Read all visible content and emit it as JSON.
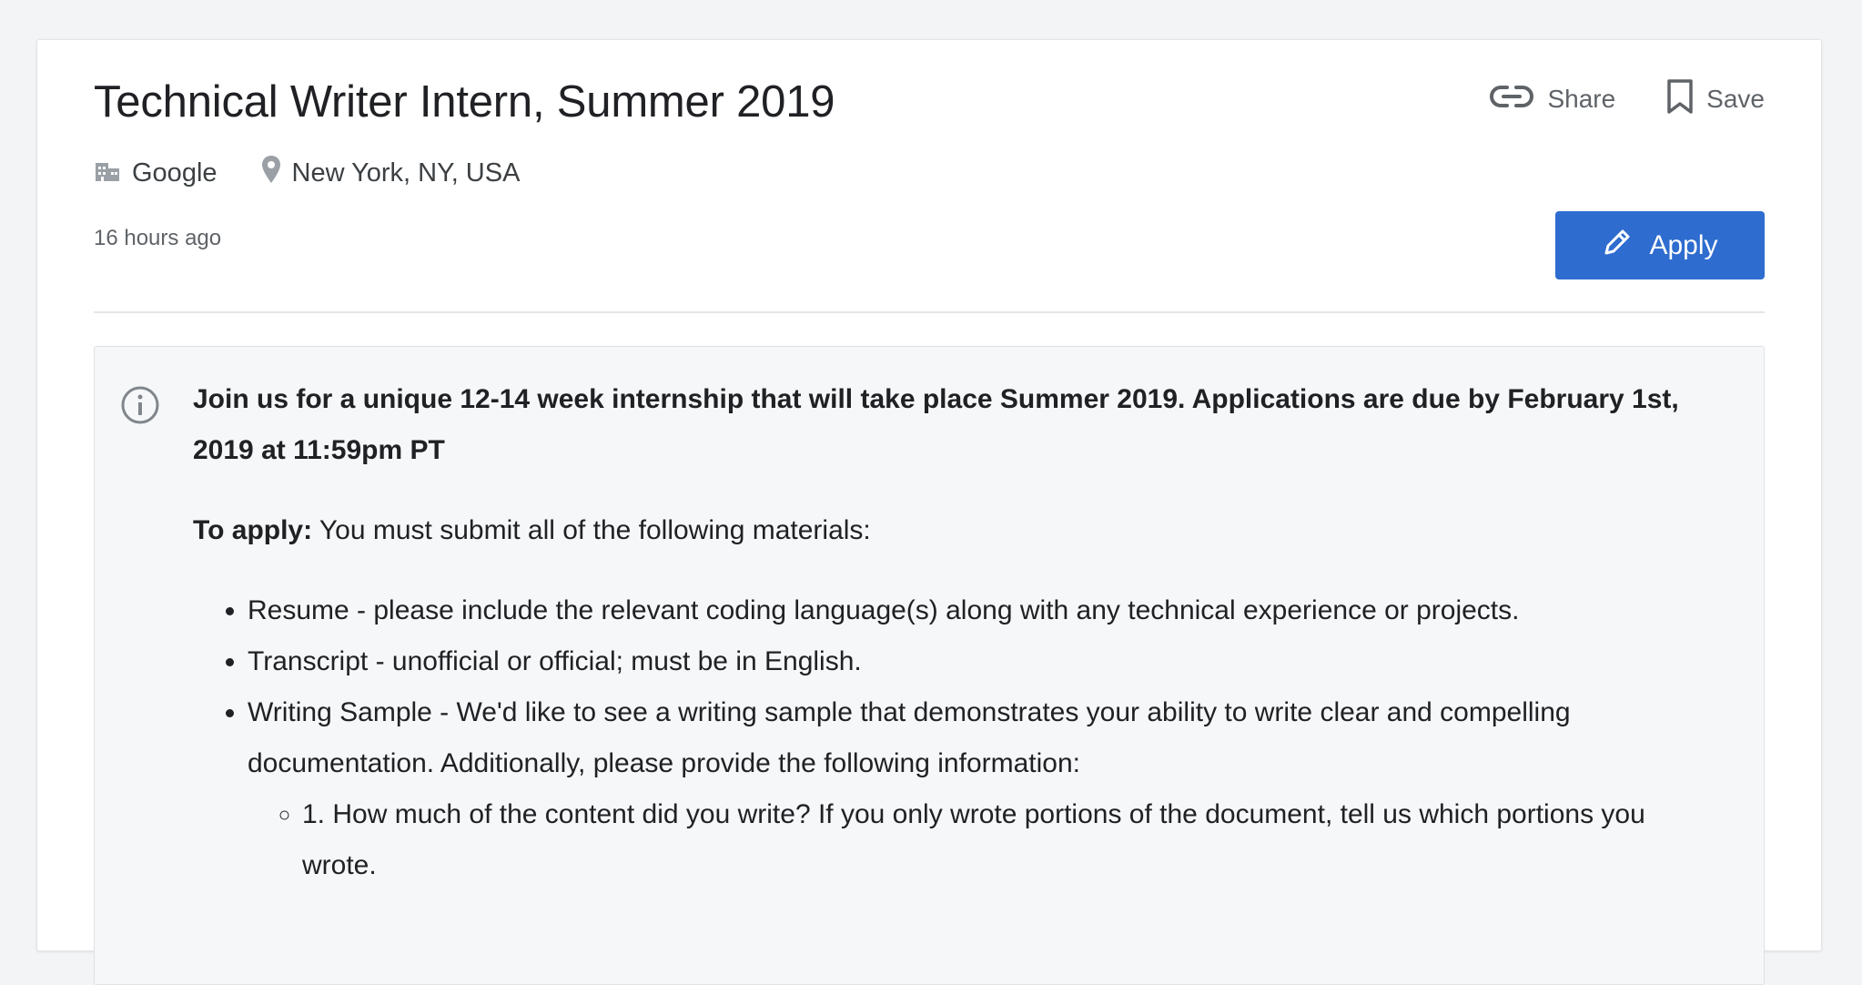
{
  "job": {
    "title": "Technical Writer Intern, Summer 2019",
    "company": "Google",
    "location": "New York, NY, USA",
    "posted": "16 hours ago"
  },
  "actions": {
    "share_label": "Share",
    "save_label": "Save",
    "apply_label": "Apply"
  },
  "notice": {
    "lead": "Join us for a unique 12-14 week internship that will take place Summer 2019. Applications are due by February 1st, 2019 at 11:59pm PT",
    "to_apply_label": "To apply:",
    "to_apply_text": " You must submit all of the following materials:",
    "requirements": [
      "Resume - please include the relevant coding language(s) along with any technical experience or projects.",
      "Transcript - unofficial or official; must be in English.",
      "Writing Sample - We'd like to see a writing sample that demonstrates your ability to write clear and compelling documentation. Additionally, please provide the following information:"
    ],
    "sub_requirements": [
      "1. How much of the content did you write? If you only wrote portions of the document, tell us which portions you wrote."
    ]
  },
  "icons": {
    "share": "link-icon",
    "save": "bookmark-icon",
    "company": "building-icon",
    "location": "location-pin-icon",
    "apply": "pencil-icon",
    "notice": "info-icon"
  },
  "colors": {
    "accent": "#2e6ccf",
    "page_background": "#f3f4f6",
    "notice_background": "#f6f7f9",
    "secondary_text": "#5f6368"
  }
}
